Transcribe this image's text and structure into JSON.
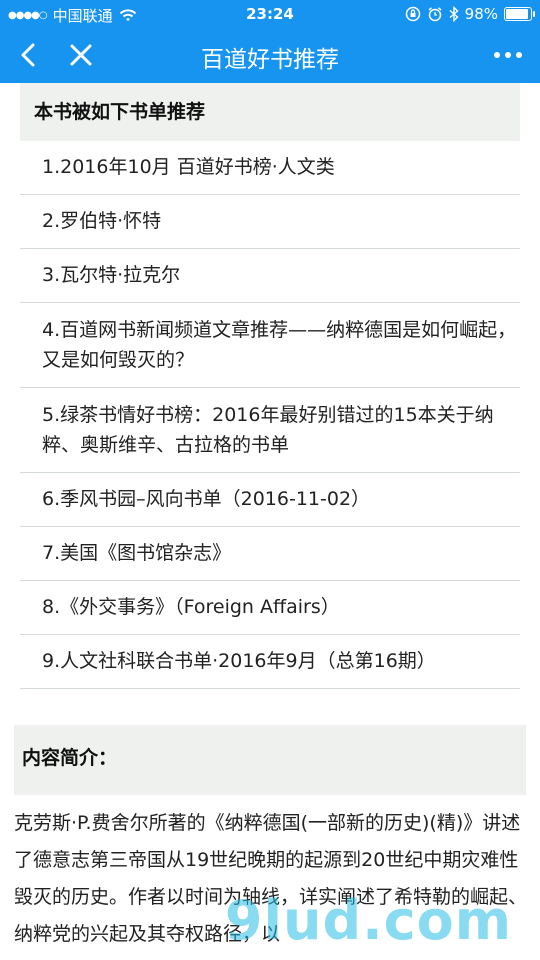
{
  "status_bar": {
    "carrier": "中国联通",
    "time": "23:24",
    "battery": "98%",
    "battery_level": 0.98
  },
  "nav": {
    "title": "百道好书推荐"
  },
  "recommend": {
    "header": "本书被如下书单推荐",
    "items": [
      "1.2016年10月 百道好书榜·人文类",
      "2.罗伯特·怀特",
      "3.瓦尔特·拉克尔",
      "4.百道网书新闻频道文章推荐——纳粹德国是如何崛起，又是如何毁灭的？",
      "5.绿茶书情好书榜：2016年最好别错过的15本关于纳粹、奥斯维辛、古拉格的书单",
      "6.季风书园–风向书单（2016-11-02）",
      "7.美国《图书馆杂志》",
      "8.《外交事务》（Foreign Affairs）",
      "9.人文社科联合书单·2016年9月（总第16期）"
    ]
  },
  "intro": {
    "header": "内容简介：",
    "text": "克劳斯·P.费舍尔所著的《纳粹德国(一部新的历史)(精)》讲述了德意志第三帝国从19世纪晚期的起源到20世纪中期灾难性毁灭的历史。作者以时间为轴线，详实阐述了希特勒的崛起、纳粹党的兴起及其夺权路径，以"
  },
  "watermark": "9lud.com"
}
